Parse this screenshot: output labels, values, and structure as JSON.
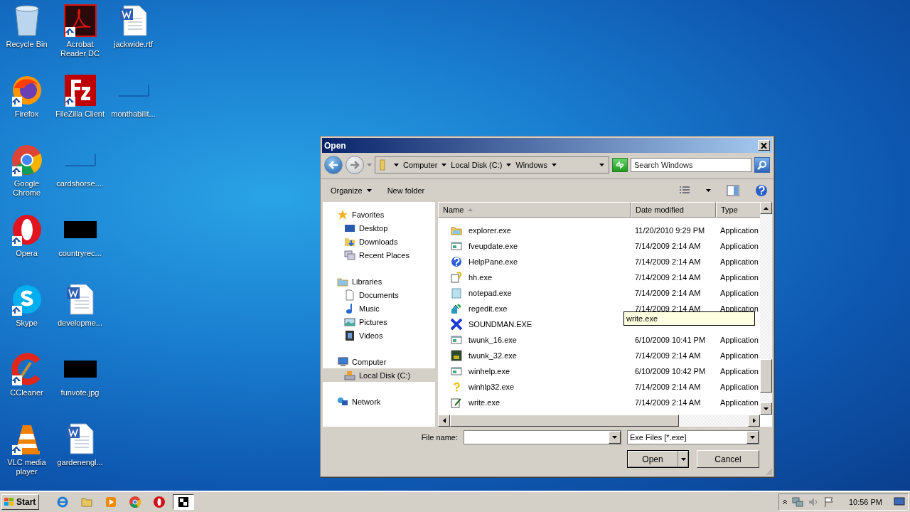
{
  "desktop_icons": [
    {
      "label": "Recycle Bin",
      "kind": "recycle",
      "shortcut": false
    },
    {
      "label": "Firefox",
      "kind": "firefox",
      "shortcut": true
    },
    {
      "label": "Google Chrome",
      "kind": "chrome",
      "shortcut": true
    },
    {
      "label": "Opera",
      "kind": "opera",
      "shortcut": true
    },
    {
      "label": "Skype",
      "kind": "skype",
      "shortcut": true
    },
    {
      "label": "CCleaner",
      "kind": "ccleaner",
      "shortcut": true
    },
    {
      "label": "VLC media player",
      "kind": "vlc",
      "shortcut": true
    },
    {
      "label": "Acrobat Reader DC",
      "kind": "pdf",
      "shortcut": true
    },
    {
      "label": "FileZilla Client",
      "kind": "filezilla",
      "shortcut": true
    },
    {
      "label": "cardshorse....",
      "kind": "blank",
      "shortcut": false
    },
    {
      "label": "countryrec...",
      "kind": "black",
      "shortcut": false
    },
    {
      "label": "developme...",
      "kind": "word",
      "shortcut": false
    },
    {
      "label": "funvote.jpg",
      "kind": "black",
      "shortcut": false
    },
    {
      "label": "gardenengl...",
      "kind": "word",
      "shortcut": false
    },
    {
      "label": "jackwide.rtf",
      "kind": "word",
      "shortcut": false
    },
    {
      "label": "monthabilit...",
      "kind": "blank",
      "shortcut": false
    }
  ],
  "dialog": {
    "title": "Open",
    "breadcrumb": [
      "Computer",
      "Local Disk (C:)",
      "Windows"
    ],
    "search": {
      "placeholder": "Search Windows"
    },
    "toolbar": {
      "organize": "Organize",
      "new_folder": "New folder"
    },
    "sidebar": [
      {
        "label": "Favorites",
        "kind": "star",
        "selected": false,
        "children": [
          {
            "label": "Desktop",
            "kind": "desktop",
            "selected": false
          },
          {
            "label": "Downloads",
            "kind": "download",
            "selected": false
          },
          {
            "label": "Recent Places",
            "kind": "recent",
            "selected": false
          }
        ]
      },
      {
        "label": "Libraries",
        "kind": "library",
        "selected": false,
        "children": [
          {
            "label": "Documents",
            "kind": "document",
            "selected": false
          },
          {
            "label": "Music",
            "kind": "music",
            "selected": false
          },
          {
            "label": "Pictures",
            "kind": "picture",
            "selected": false
          },
          {
            "label": "Videos",
            "kind": "video",
            "selected": false
          }
        ]
      },
      {
        "label": "Computer",
        "kind": "computer",
        "selected": false,
        "children": [
          {
            "label": "Local Disk (C:)",
            "kind": "disk",
            "selected": true
          }
        ]
      },
      {
        "label": "Network",
        "kind": "network",
        "selected": false
      }
    ],
    "columns": [
      {
        "label": "Name",
        "sorted": true
      },
      {
        "label": "Date modified",
        "sorted": false
      },
      {
        "label": "Type",
        "sorted": false
      }
    ],
    "files": [
      {
        "name": "explorer.exe",
        "kind": "explorer",
        "date": "11/20/2010 9:29 PM",
        "type": "Application",
        "selected": false
      },
      {
        "name": "fveupdate.exe",
        "kind": "window",
        "date": "7/14/2009 2:14 AM",
        "type": "Application",
        "selected": false
      },
      {
        "name": "HelpPane.exe",
        "kind": "help",
        "date": "7/14/2009 2:14 AM",
        "type": "Application",
        "selected": false
      },
      {
        "name": "hh.exe",
        "kind": "hh",
        "date": "7/14/2009 2:14 AM",
        "type": "Application",
        "selected": false
      },
      {
        "name": "notepad.exe",
        "kind": "notepad",
        "date": "7/14/2009 2:14 AM",
        "type": "Application",
        "selected": false
      },
      {
        "name": "regedit.exe",
        "kind": "regedit",
        "date": "7/14/2009 2:14 AM",
        "type": "Application",
        "selected": false
      },
      {
        "name": "SOUNDMAN.EXE",
        "kind": "soundman",
        "selected": false
      },
      {
        "name": "twunk_16.exe",
        "kind": "window",
        "date": "6/10/2009 10:41 PM",
        "type": "Application",
        "selected": false
      },
      {
        "name": "twunk_32.exe",
        "kind": "twunk",
        "date": "7/14/2009 2:14 AM",
        "type": "Application",
        "selected": false
      },
      {
        "name": "winhelp.exe",
        "kind": "window",
        "date": "6/10/2009 10:42 PM",
        "type": "Application",
        "selected": false
      },
      {
        "name": "winhlp32.exe",
        "kind": "winhlp",
        "date": "7/14/2009 2:14 AM",
        "type": "Application",
        "selected": false
      },
      {
        "name": "write.exe",
        "kind": "write",
        "date": "7/14/2009 2:14 AM",
        "type": "Application",
        "selected": false
      }
    ],
    "tooltip": "write.exe",
    "file_name_label": "File name:",
    "file_type": "Exe Files [*.exe]",
    "open_button": "Open",
    "cancel_button": "Cancel"
  },
  "taskbar": {
    "start": "Start",
    "apps": [
      {
        "kind": "ie",
        "active": false
      },
      {
        "kind": "folder",
        "active": false
      },
      {
        "kind": "media",
        "active": false
      },
      {
        "kind": "chrome",
        "active": false
      },
      {
        "kind": "opera",
        "active": false
      },
      {
        "kind": "app",
        "active": true
      }
    ],
    "clock": "10:56 PM"
  }
}
